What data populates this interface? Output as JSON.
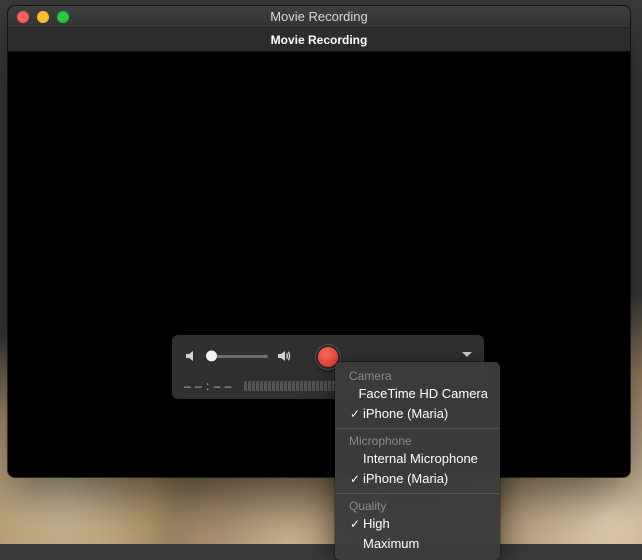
{
  "window": {
    "title": "Movie Recording",
    "subheader": "Movie Recording"
  },
  "hud": {
    "timecode": "– – : – –",
    "volume_percent": 0,
    "level_bar_count": 34
  },
  "menu": {
    "sections": [
      {
        "heading": "Camera",
        "items": [
          {
            "label": "FaceTime HD Camera",
            "checked": false
          },
          {
            "label": "iPhone (Maria)",
            "checked": true
          }
        ]
      },
      {
        "heading": "Microphone",
        "items": [
          {
            "label": "Internal Microphone",
            "checked": false
          },
          {
            "label": "iPhone (Maria)",
            "checked": true
          }
        ]
      },
      {
        "heading": "Quality",
        "items": [
          {
            "label": "High",
            "checked": true
          },
          {
            "label": "Maximum",
            "checked": false
          }
        ]
      }
    ]
  }
}
